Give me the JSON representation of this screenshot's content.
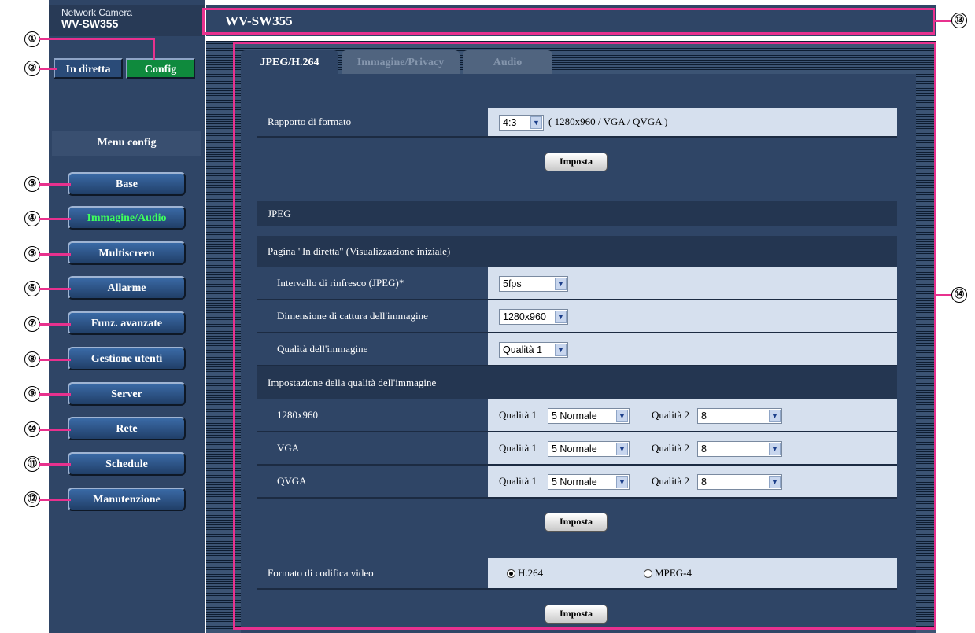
{
  "brand": {
    "line1": "Network Camera",
    "line2": "WV-SW355"
  },
  "header": {
    "title": "WV-SW355"
  },
  "top_buttons": {
    "live": "In diretta",
    "config": "Config"
  },
  "menu": {
    "title": "Menu config",
    "items": [
      "Base",
      "Immagine/Audio",
      "Multiscreen",
      "Allarme",
      "Funz. avanzate",
      "Gestione utenti",
      "Server",
      "Rete",
      "Schedule",
      "Manutenzione"
    ],
    "active": "Immagine/Audio"
  },
  "callouts": [
    "①",
    "②",
    "③",
    "④",
    "⑤",
    "⑥",
    "⑦",
    "⑧",
    "⑨",
    "⑩",
    "⑪",
    "⑫",
    "⑬",
    "⑭"
  ],
  "tabs": [
    "JPEG/H.264",
    "Immagine/Privacy",
    "Audio"
  ],
  "aspect": {
    "label": "Rapporto di formato",
    "value": "4:3",
    "note": "( 1280x960 / VGA / QVGA )"
  },
  "set_label": "Imposta",
  "jpeg": {
    "heading": "JPEG",
    "live_heading": "Pagina \"In diretta\" (Visualizzazione iniziale)",
    "refresh": {
      "label": "Intervallo di rinfresco (JPEG)*",
      "value": "5fps"
    },
    "capture": {
      "label": "Dimensione di cattura dell'immagine",
      "value": "1280x960"
    },
    "quality": {
      "label": "Qualità dell'immagine",
      "value": "Qualità 1"
    },
    "quality_heading": "Impostazione della qualità dell'immagine",
    "quality_rows": [
      {
        "label": "1280x960",
        "q1_label": "Qualità 1",
        "q1_value": "5 Normale",
        "q2_label": "Qualità 2",
        "q2_value": "8"
      },
      {
        "label": "VGA",
        "q1_label": "Qualità 1",
        "q1_value": "5 Normale",
        "q2_label": "Qualità 2",
        "q2_value": "8"
      },
      {
        "label": "QVGA",
        "q1_label": "Qualità 1",
        "q1_value": "5 Normale",
        "q2_label": "Qualità 2",
        "q2_value": "8"
      }
    ]
  },
  "codec": {
    "label": "Formato di codifica video",
    "options": [
      "H.264",
      "MPEG-4"
    ],
    "selected": "H.264"
  },
  "colors": {
    "accent_pink": "#e8318e",
    "panel": "#2f4566",
    "active_green": "#3dff5e",
    "config_button": "#0f8a3d"
  },
  "icons": {
    "dropdown": "chevron-down-icon",
    "radio": "radio-icon"
  }
}
